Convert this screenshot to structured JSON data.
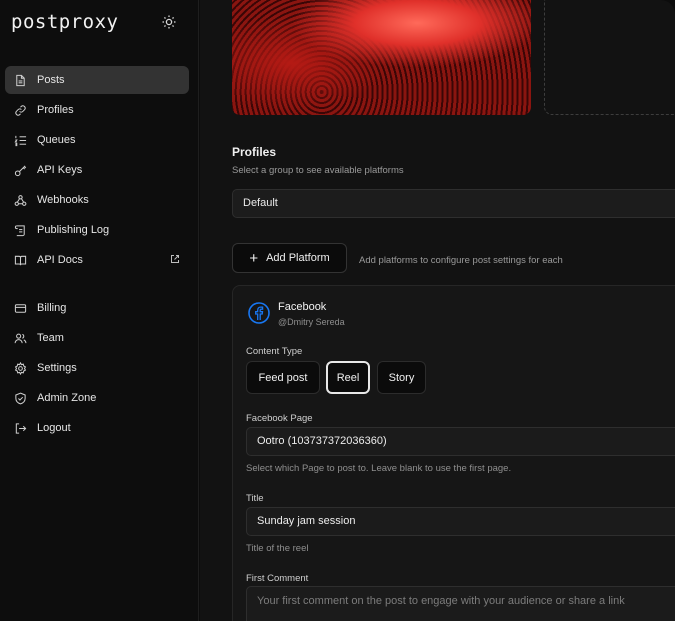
{
  "app": {
    "logo": "postproxy"
  },
  "sidebar": {
    "items": [
      {
        "label": "Posts",
        "icon": "document-icon",
        "active": true
      },
      {
        "label": "Profiles",
        "icon": "link-icon"
      },
      {
        "label": "Queues",
        "icon": "list-ordered-icon"
      },
      {
        "label": "API Keys",
        "icon": "key-icon"
      },
      {
        "label": "Webhooks",
        "icon": "webhook-icon"
      },
      {
        "label": "Publishing Log",
        "icon": "scroll-icon"
      },
      {
        "label": "API Docs",
        "icon": "book-icon",
        "external": true
      }
    ],
    "items2": [
      {
        "label": "Billing",
        "icon": "credit-card-icon"
      },
      {
        "label": "Team",
        "icon": "users-icon"
      },
      {
        "label": "Settings",
        "icon": "gear-icon"
      },
      {
        "label": "Admin Zone",
        "icon": "shield-icon"
      },
      {
        "label": "Logout",
        "icon": "logout-icon"
      }
    ]
  },
  "profiles": {
    "title": "Profiles",
    "subtitle": "Select a group to see available platforms",
    "selected_group": "Default"
  },
  "platforms": {
    "add_label": "Add Platform",
    "hint": "Add platforms to configure post settings for each"
  },
  "facebook": {
    "name": "Facebook",
    "user": "@Dmitry Sereda",
    "brand_color": "#1877f2",
    "content_type_label": "Content Type",
    "content_types": [
      "Feed post",
      "Reel",
      "Story"
    ],
    "selected_content_type": "Reel",
    "page_label": "Facebook Page",
    "page_value": "Ootro (103737372036360)",
    "page_help": "Select which Page to post to. Leave blank to use the first page.",
    "title_label": "Title",
    "title_value": "Sunday jam session",
    "title_help": "Title of the reel",
    "comment_label": "First Comment",
    "comment_placeholder": "Your first comment on the post to engage with your audience or share a link"
  }
}
